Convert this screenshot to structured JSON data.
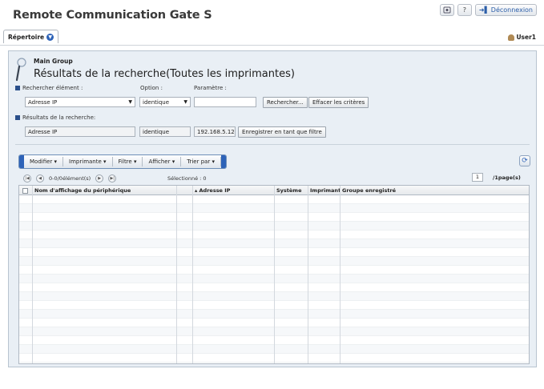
{
  "app": {
    "title": "Remote Communication Gate S"
  },
  "topbar": {
    "help_label": "?",
    "logout_label": "Déconnexion"
  },
  "menubar": {
    "directory_label": "Répertoire",
    "user_label": "User1"
  },
  "header": {
    "group_name": "Main Group",
    "page_title": "Résultats de la recherche(Toutes les imprimantes)"
  },
  "search": {
    "element_label": "Rechercher élément :",
    "option_label": "Option :",
    "parameter_label": "Paramètre :",
    "element_value": "Adresse IP",
    "option_value": "identique",
    "parameter_value": "",
    "search_button": "Rechercher...",
    "clear_button": "Effacer les critères"
  },
  "results": {
    "label": "Résultats de la recherche:",
    "element_value": "Adresse IP",
    "option_value": "identique",
    "parameter_value": "192.168.5.12",
    "save_filter_button": "Enregistrer en tant que filtre"
  },
  "toolbar": {
    "items": [
      "Modifier ▾",
      "Imprimante ▾",
      "Filtre ▾",
      "Afficher ▾",
      "Trier par ▾"
    ]
  },
  "pager": {
    "range_text": "0-0/0élément(s)",
    "selected_text": "Sélectionné : 0",
    "page_value": "1",
    "page_total": "/1page(s)"
  },
  "grid": {
    "columns": [
      "Nom d'affichage du périphérique",
      "▴ Adresse IP",
      "Système",
      "Imprimante",
      "Groupe enregistré"
    ],
    "empty_rows": 19
  }
}
